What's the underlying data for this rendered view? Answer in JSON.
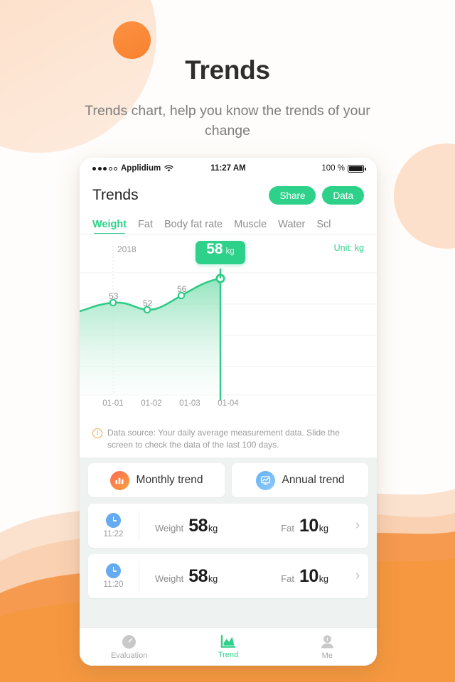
{
  "header": {
    "title": "Trends",
    "subtitle": "Trends chart, help you know the trends of your change"
  },
  "theme": {
    "green": "#2ed18a",
    "orange": "#f8822f",
    "peach": "#fde0cb",
    "gray_text": "#8c8c8c"
  },
  "phone": {
    "statusbar": {
      "carrier": "Applidium",
      "time": "11:27 AM",
      "battery": "100 %",
      "wifi_icon": "wifi-icon",
      "battery_icon": "battery-icon",
      "signal_icon": "signal-dots-icon"
    },
    "navbar": {
      "title": "Trends",
      "share_label": "Share",
      "data_label": "Data"
    },
    "tabs": [
      {
        "label": "Weight",
        "active": true
      },
      {
        "label": "Fat",
        "active": false
      },
      {
        "label": "Body fat rate",
        "active": false
      },
      {
        "label": "Muscle",
        "active": false
      },
      {
        "label": "Water",
        "active": false
      },
      {
        "label": "Scl",
        "active": false
      }
    ],
    "chart": {
      "unit_label": "Unit:  kg",
      "year_marker": "2018",
      "tooltip_value": "58",
      "tooltip_unit": "kg"
    },
    "note": {
      "icon": "info-circle-icon",
      "icon_glyph": "i",
      "text": "Data source: Your daily average measurement data. Slide the screen to check the data of the last 100 days."
    },
    "trend_buttons": [
      {
        "label": "Monthly trend",
        "icon": "bar-chart-icon"
      },
      {
        "label": "Annual trend",
        "icon": "line-chart-icon"
      }
    ],
    "records": [
      {
        "time": "11:22",
        "clock_icon": "clock-icon",
        "weight_name": "Weight",
        "weight_value": "58",
        "weight_unit": "kg",
        "fat_name": "Fat",
        "fat_value": "10",
        "fat_unit": "kg",
        "chevron": "›"
      },
      {
        "time": "11:20",
        "clock_icon": "clock-icon",
        "weight_name": "Weight",
        "weight_value": "58",
        "weight_unit": "kg",
        "fat_name": "Fat",
        "fat_value": "10",
        "fat_unit": "kg",
        "chevron": "›"
      }
    ],
    "tabbar": [
      {
        "label": "Evaluation",
        "icon": "gauge-icon",
        "active": false
      },
      {
        "label": "Trend",
        "icon": "trend-chart-icon",
        "active": true
      },
      {
        "label": "Me",
        "icon": "person-icon",
        "active": false
      }
    ]
  },
  "chart_data": {
    "type": "area",
    "title": "Weight trend",
    "xlabel": "",
    "ylabel": "kg",
    "unit": "kg",
    "categories": [
      "01-01",
      "01-02",
      "01-03",
      "01-04"
    ],
    "values": [
      53,
      52,
      56,
      58
    ],
    "point_labels": [
      "53",
      "52",
      "56",
      "58"
    ],
    "highlighted_index": 3,
    "highlight_label": "58 kg",
    "year_annotation": "2018",
    "ylim": [
      44,
      62
    ],
    "grid": true,
    "legend": false,
    "line_color": "#2ed18a",
    "fill_gradient": [
      "#9ee7c3",
      "#f4fcf8"
    ]
  }
}
